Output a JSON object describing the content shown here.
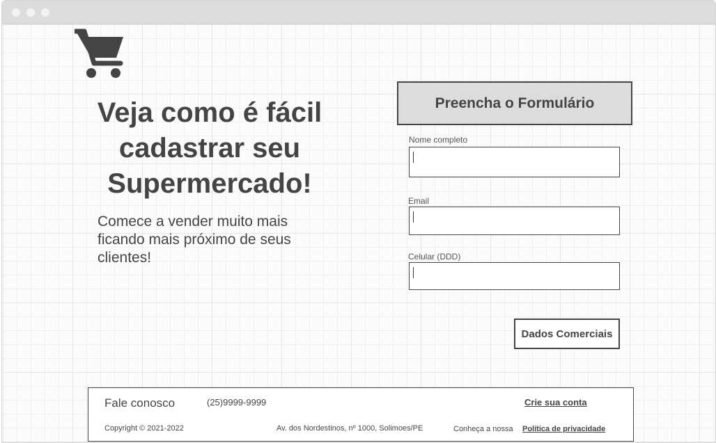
{
  "icons": {
    "logo": "shopping-cart-icon"
  },
  "hero": {
    "headline": "Veja como é fácil cadastrar seu Supermercado!",
    "subtitle": "Comece a vender muito mais ficando mais próximo de seus clientes!"
  },
  "form": {
    "header": "Preencha o Formulário",
    "fields": [
      {
        "label": "Nome completo",
        "value": ""
      },
      {
        "label": "Email",
        "value": ""
      },
      {
        "label": "Celular (DDD)",
        "value": ""
      }
    ],
    "submit_label": "Dados Comerciais"
  },
  "footer": {
    "contact_label": "Fale conosco",
    "phone": "(25)9999-9999",
    "create_account": "Crie sua conta",
    "copyright": "Copyright © 2021-2022",
    "address": "Av. dos Nordestinos, nº 1000, Solimoes/PE",
    "privacy_prefix": "Conheça a nossa",
    "privacy_link": "Política de privacidade"
  },
  "colors": {
    "text": "#444444",
    "header_bg": "#dcdcdc",
    "border": "#444444"
  }
}
